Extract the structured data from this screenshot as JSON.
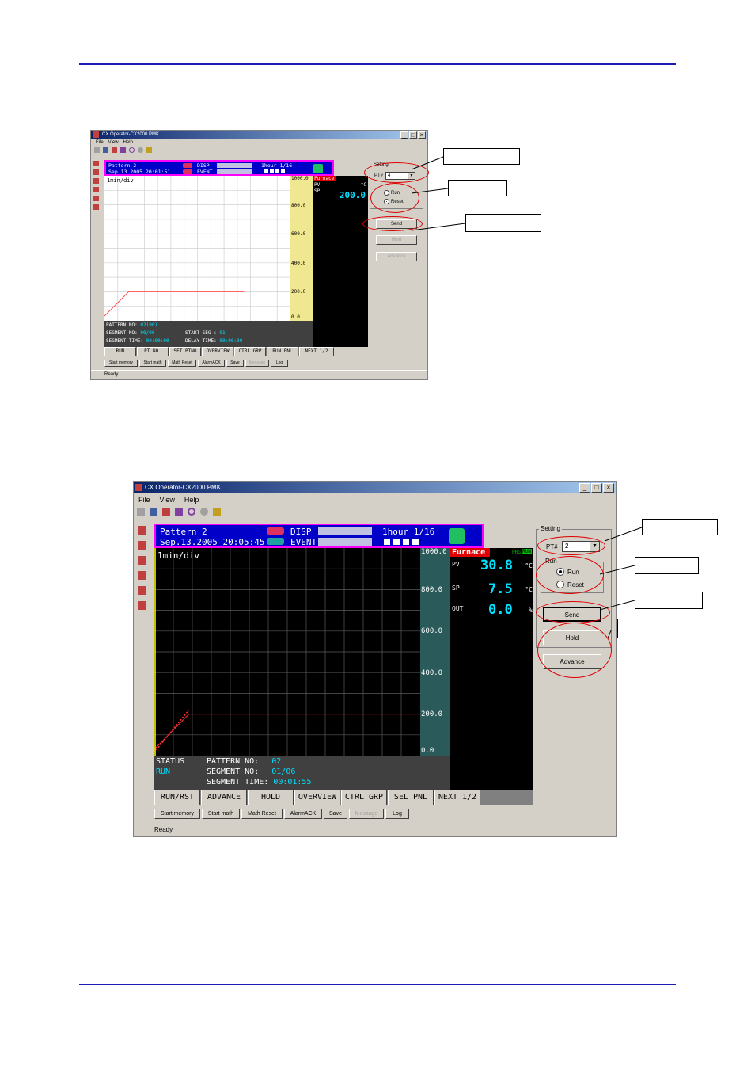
{
  "screens": [
    {
      "title": "CX Operator-CX2000 PMK",
      "menu": [
        "File",
        "View",
        "Help"
      ],
      "header": {
        "pattern": "Pattern 2",
        "datetime": "Sep.13.2005 20:01:51",
        "disp_label": "DISP",
        "event_label": "EVENT",
        "scale": "1hour 1/16"
      },
      "plot_label": "1min/div",
      "scale_ticks": [
        "1000.0",
        "800.0",
        "600.0",
        "400.0",
        "200.0",
        "0.0"
      ],
      "panel": {
        "name": "Furnace",
        "unit": "°C",
        "rows": [
          {
            "label": "PV",
            "value": ""
          },
          {
            "label": "SP",
            "value": "200.0"
          }
        ]
      },
      "status": {
        "row1": {
          "label": "PATTERN NO:",
          "value": "02(00)"
        },
        "row2": {
          "label": "SEGMENT NO:",
          "value": "00/00",
          "extra_label": "START SEG :",
          "extra_value": "01"
        },
        "row3": {
          "label": "SEGMENT TIME:",
          "value": "00:00:00",
          "extra_label": "DELAY TIME:",
          "extra_value": "00:00:00"
        }
      },
      "softkeys": [
        "RUN",
        "PT NO.",
        "SET PTNO",
        "OVERVIEW",
        "CTRL GRP",
        "RUN PNL",
        "NEXT 1/2"
      ],
      "buttons": [
        "Start memory",
        "Start math",
        "Math Reset",
        "AlarmACK",
        "Save",
        "Message",
        "Log"
      ],
      "status_text": "Ready",
      "setting": {
        "label": "Setting",
        "pt_label": "PT#",
        "pt_value": "4",
        "run": "Run",
        "reset": "Reset",
        "send": "Send",
        "hold": "Hold",
        "advance": "Advance",
        "selected": "reset"
      },
      "callouts": [
        "",
        "",
        ""
      ]
    },
    {
      "title": "CX Operator-CX2000 PMK",
      "menu": [
        "File",
        "View",
        "Help"
      ],
      "header": {
        "pattern": "Pattern 2",
        "datetime": "Sep.13.2005 20:05:45",
        "disp_label": "DISP",
        "event_label": "EVENT",
        "scale": "1hour 1/16"
      },
      "plot_label": "1min/div",
      "scale_ticks": [
        "1000.0",
        "800.0",
        "600.0",
        "400.0",
        "200.0",
        "0.0"
      ],
      "panel": {
        "name": "Furnace",
        "tag": "PRG",
        "tag2": "RUN",
        "unit": "°C",
        "rows": [
          {
            "label": "PV",
            "value": "30.8",
            "unit": "°C"
          },
          {
            "label": "SP",
            "value": "7.5",
            "unit": "°C"
          },
          {
            "label": "OUT",
            "value": "0.0",
            "unit": "%"
          }
        ]
      },
      "status": {
        "status_label": "STATUS",
        "status_value": "RUN",
        "row1": {
          "label": "PATTERN NO:",
          "value": "02"
        },
        "row2": {
          "label": "SEGMENT NO:",
          "value": "01/06"
        },
        "row3": {
          "label": "SEGMENT TIME:",
          "value": "00:01:55"
        }
      },
      "softkeys": [
        "RUN/RST",
        "ADVANCE",
        "HOLD",
        "OVERVIEW",
        "CTRL GRP",
        "SEL PNL",
        "NEXT 1/2"
      ],
      "buttons": [
        "Start memory",
        "Start math",
        "Math Reset",
        "AlarmACK",
        "Save",
        "Message",
        "Log"
      ],
      "status_text": "Ready",
      "setting": {
        "label": "Setting",
        "pt_label": "PT#",
        "pt_value": "2",
        "run_group": "Run",
        "run": "Run",
        "reset": "Reset",
        "send": "Send",
        "hold": "Hold",
        "advance": "Advance",
        "selected": "run"
      },
      "callouts": [
        "",
        "",
        "",
        ""
      ]
    }
  ],
  "colors": {
    "rule": "#1a1ab4",
    "header_bg": "#0000c8",
    "accent_red": "#e00000",
    "cyan": "#00e0ff",
    "scale1": "#f0e890",
    "scale2": "#2a5a5a"
  }
}
